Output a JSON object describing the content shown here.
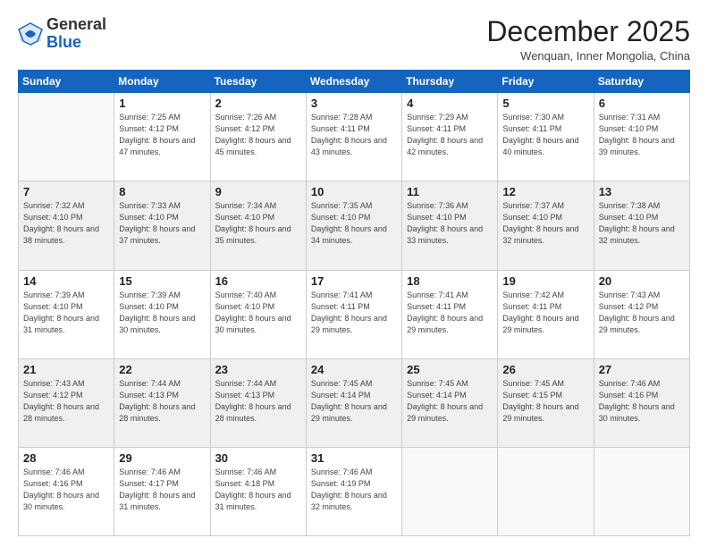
{
  "logo": {
    "general": "General",
    "blue": "Blue"
  },
  "header": {
    "month": "December 2025",
    "location": "Wenquan, Inner Mongolia, China"
  },
  "weekdays": [
    "Sunday",
    "Monday",
    "Tuesday",
    "Wednesday",
    "Thursday",
    "Friday",
    "Saturday"
  ],
  "weeks": [
    [
      {
        "day": "",
        "sunrise": "",
        "sunset": "",
        "daylight": ""
      },
      {
        "day": "1",
        "sunrise": "Sunrise: 7:25 AM",
        "sunset": "Sunset: 4:12 PM",
        "daylight": "Daylight: 8 hours and 47 minutes."
      },
      {
        "day": "2",
        "sunrise": "Sunrise: 7:26 AM",
        "sunset": "Sunset: 4:12 PM",
        "daylight": "Daylight: 8 hours and 45 minutes."
      },
      {
        "day": "3",
        "sunrise": "Sunrise: 7:28 AM",
        "sunset": "Sunset: 4:11 PM",
        "daylight": "Daylight: 8 hours and 43 minutes."
      },
      {
        "day": "4",
        "sunrise": "Sunrise: 7:29 AM",
        "sunset": "Sunset: 4:11 PM",
        "daylight": "Daylight: 8 hours and 42 minutes."
      },
      {
        "day": "5",
        "sunrise": "Sunrise: 7:30 AM",
        "sunset": "Sunset: 4:11 PM",
        "daylight": "Daylight: 8 hours and 40 minutes."
      },
      {
        "day": "6",
        "sunrise": "Sunrise: 7:31 AM",
        "sunset": "Sunset: 4:10 PM",
        "daylight": "Daylight: 8 hours and 39 minutes."
      }
    ],
    [
      {
        "day": "7",
        "sunrise": "Sunrise: 7:32 AM",
        "sunset": "Sunset: 4:10 PM",
        "daylight": "Daylight: 8 hours and 38 minutes."
      },
      {
        "day": "8",
        "sunrise": "Sunrise: 7:33 AM",
        "sunset": "Sunset: 4:10 PM",
        "daylight": "Daylight: 8 hours and 37 minutes."
      },
      {
        "day": "9",
        "sunrise": "Sunrise: 7:34 AM",
        "sunset": "Sunset: 4:10 PM",
        "daylight": "Daylight: 8 hours and 35 minutes."
      },
      {
        "day": "10",
        "sunrise": "Sunrise: 7:35 AM",
        "sunset": "Sunset: 4:10 PM",
        "daylight": "Daylight: 8 hours and 34 minutes."
      },
      {
        "day": "11",
        "sunrise": "Sunrise: 7:36 AM",
        "sunset": "Sunset: 4:10 PM",
        "daylight": "Daylight: 8 hours and 33 minutes."
      },
      {
        "day": "12",
        "sunrise": "Sunrise: 7:37 AM",
        "sunset": "Sunset: 4:10 PM",
        "daylight": "Daylight: 8 hours and 32 minutes."
      },
      {
        "day": "13",
        "sunrise": "Sunrise: 7:38 AM",
        "sunset": "Sunset: 4:10 PM",
        "daylight": "Daylight: 8 hours and 32 minutes."
      }
    ],
    [
      {
        "day": "14",
        "sunrise": "Sunrise: 7:39 AM",
        "sunset": "Sunset: 4:10 PM",
        "daylight": "Daylight: 8 hours and 31 minutes."
      },
      {
        "day": "15",
        "sunrise": "Sunrise: 7:39 AM",
        "sunset": "Sunset: 4:10 PM",
        "daylight": "Daylight: 8 hours and 30 minutes."
      },
      {
        "day": "16",
        "sunrise": "Sunrise: 7:40 AM",
        "sunset": "Sunset: 4:10 PM",
        "daylight": "Daylight: 8 hours and 30 minutes."
      },
      {
        "day": "17",
        "sunrise": "Sunrise: 7:41 AM",
        "sunset": "Sunset: 4:11 PM",
        "daylight": "Daylight: 8 hours and 29 minutes."
      },
      {
        "day": "18",
        "sunrise": "Sunrise: 7:41 AM",
        "sunset": "Sunset: 4:11 PM",
        "daylight": "Daylight: 8 hours and 29 minutes."
      },
      {
        "day": "19",
        "sunrise": "Sunrise: 7:42 AM",
        "sunset": "Sunset: 4:11 PM",
        "daylight": "Daylight: 8 hours and 29 minutes."
      },
      {
        "day": "20",
        "sunrise": "Sunrise: 7:43 AM",
        "sunset": "Sunset: 4:12 PM",
        "daylight": "Daylight: 8 hours and 29 minutes."
      }
    ],
    [
      {
        "day": "21",
        "sunrise": "Sunrise: 7:43 AM",
        "sunset": "Sunset: 4:12 PM",
        "daylight": "Daylight: 8 hours and 28 minutes."
      },
      {
        "day": "22",
        "sunrise": "Sunrise: 7:44 AM",
        "sunset": "Sunset: 4:13 PM",
        "daylight": "Daylight: 8 hours and 28 minutes."
      },
      {
        "day": "23",
        "sunrise": "Sunrise: 7:44 AM",
        "sunset": "Sunset: 4:13 PM",
        "daylight": "Daylight: 8 hours and 28 minutes."
      },
      {
        "day": "24",
        "sunrise": "Sunrise: 7:45 AM",
        "sunset": "Sunset: 4:14 PM",
        "daylight": "Daylight: 8 hours and 29 minutes."
      },
      {
        "day": "25",
        "sunrise": "Sunrise: 7:45 AM",
        "sunset": "Sunset: 4:14 PM",
        "daylight": "Daylight: 8 hours and 29 minutes."
      },
      {
        "day": "26",
        "sunrise": "Sunrise: 7:45 AM",
        "sunset": "Sunset: 4:15 PM",
        "daylight": "Daylight: 8 hours and 29 minutes."
      },
      {
        "day": "27",
        "sunrise": "Sunrise: 7:46 AM",
        "sunset": "Sunset: 4:16 PM",
        "daylight": "Daylight: 8 hours and 30 minutes."
      }
    ],
    [
      {
        "day": "28",
        "sunrise": "Sunrise: 7:46 AM",
        "sunset": "Sunset: 4:16 PM",
        "daylight": "Daylight: 8 hours and 30 minutes."
      },
      {
        "day": "29",
        "sunrise": "Sunrise: 7:46 AM",
        "sunset": "Sunset: 4:17 PM",
        "daylight": "Daylight: 8 hours and 31 minutes."
      },
      {
        "day": "30",
        "sunrise": "Sunrise: 7:46 AM",
        "sunset": "Sunset: 4:18 PM",
        "daylight": "Daylight: 8 hours and 31 minutes."
      },
      {
        "day": "31",
        "sunrise": "Sunrise: 7:46 AM",
        "sunset": "Sunset: 4:19 PM",
        "daylight": "Daylight: 8 hours and 32 minutes."
      },
      {
        "day": "",
        "sunrise": "",
        "sunset": "",
        "daylight": ""
      },
      {
        "day": "",
        "sunrise": "",
        "sunset": "",
        "daylight": ""
      },
      {
        "day": "",
        "sunrise": "",
        "sunset": "",
        "daylight": ""
      }
    ]
  ]
}
